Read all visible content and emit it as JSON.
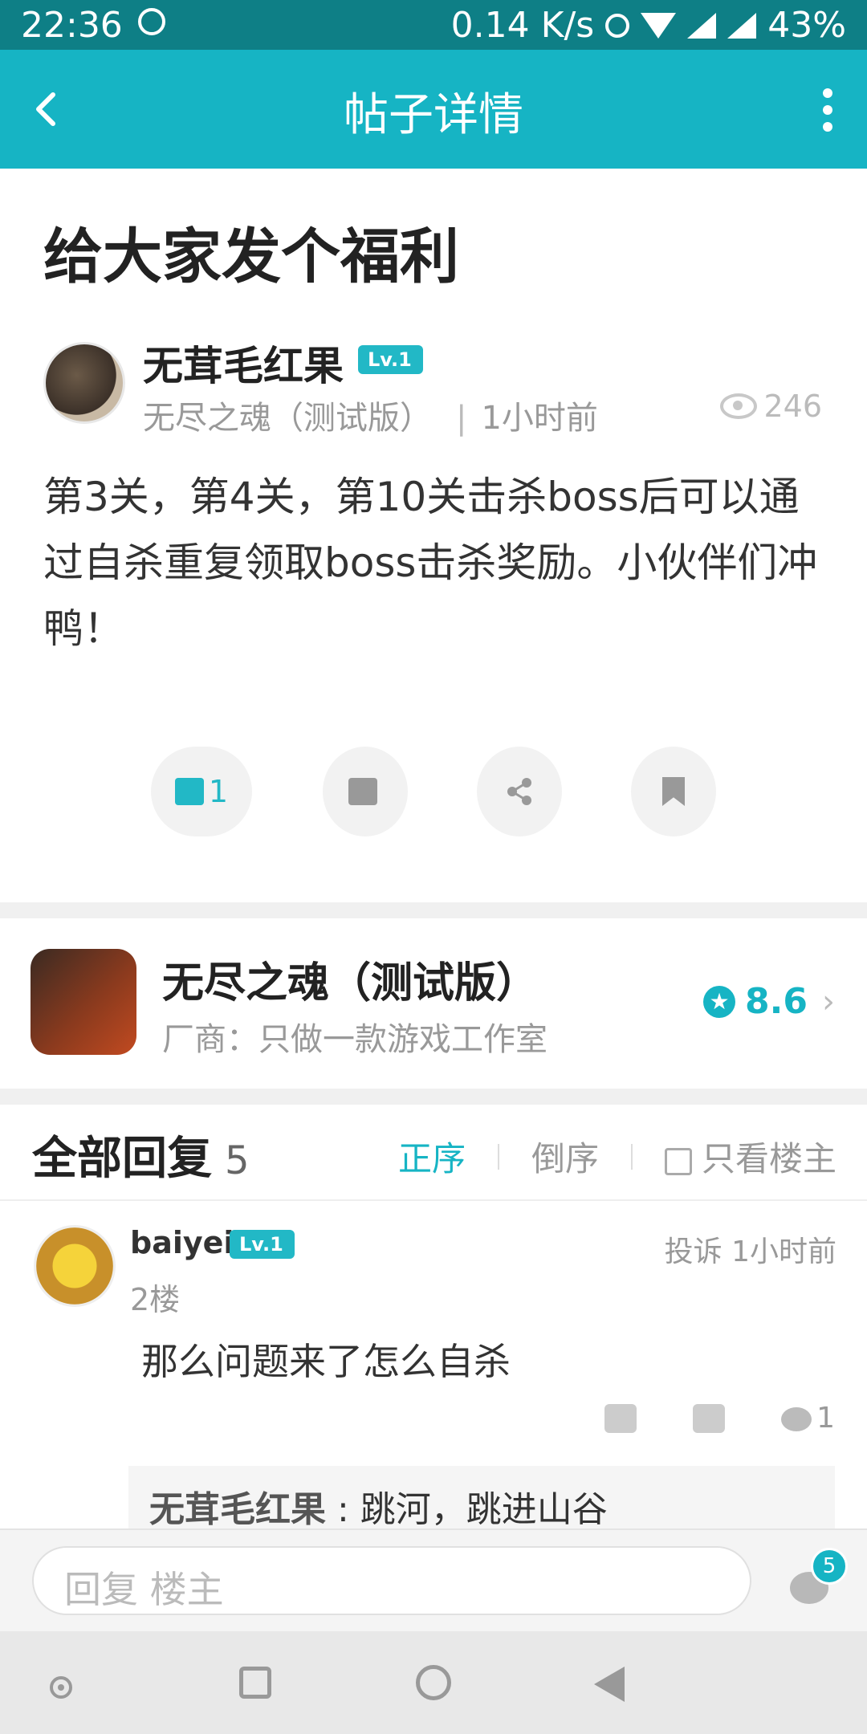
{
  "status_bar": {
    "time": "22:36",
    "net_speed": "0.14 K/s",
    "battery": "43%"
  },
  "app_bar": {
    "title": "帖子详情"
  },
  "post": {
    "title": "给大家发个福利",
    "author": "无茸毛红果",
    "author_level": "Lv.1",
    "game_tag": "无尽之魂（测试版）",
    "time": "1小时前",
    "views": "246",
    "content": "第3关，第4关，第10关击杀boss后可以通过自杀重复领取boss击杀奖励。小伙伴们冲鸭！",
    "likes": "1"
  },
  "game_card": {
    "name": "无尽之魂（测试版）",
    "vendor": "厂商：只做一款游戏工作室",
    "rating": "8.6"
  },
  "replies": {
    "header": "全部回复",
    "count": "5",
    "sort_asc": "正序",
    "sort_desc": "倒序",
    "only_op": "只看楼主",
    "items": [
      {
        "name": "baiyeil",
        "level": "Lv.1",
        "floor": "2楼",
        "report": "投诉",
        "time": "1小时前",
        "text": "那么问题来了怎么自杀",
        "comment_count": "1",
        "sub_reply_author": "无茸毛红果",
        "sub_reply_text": "跳河，跳进山谷"
      }
    ]
  },
  "input_bar": {
    "placeholder": "回复  楼主",
    "badge": "5"
  },
  "colors": {
    "accent": "#16b4c4",
    "status_bar": "#0e7f86"
  }
}
